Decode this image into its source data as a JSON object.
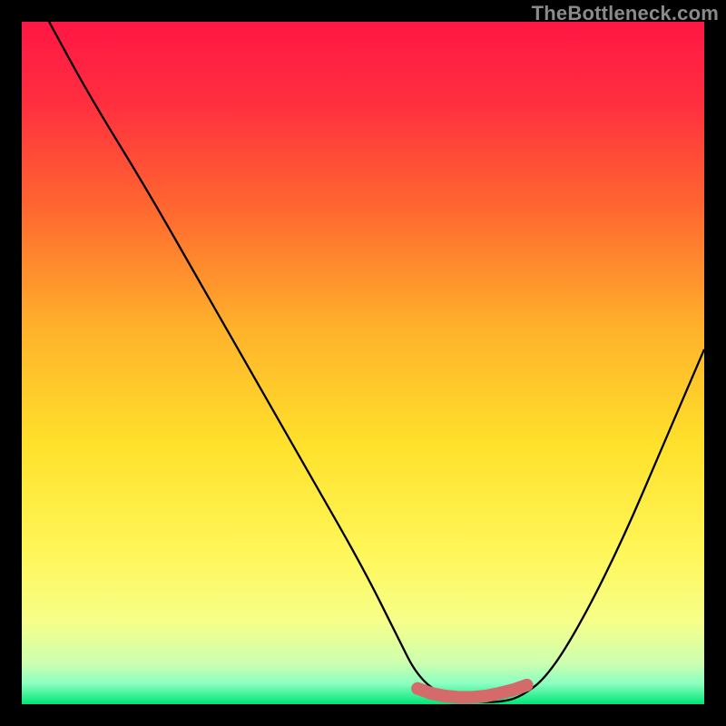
{
  "attribution": "TheBottleneck.com",
  "chart_data": {
    "type": "line",
    "title": "",
    "xlabel": "",
    "ylabel": "",
    "x_range": [
      0,
      100
    ],
    "y_range": [
      0,
      100
    ],
    "gradient_stops": [
      {
        "offset": 0.0,
        "color": "#ff1744"
      },
      {
        "offset": 0.12,
        "color": "#ff2f3f"
      },
      {
        "offset": 0.28,
        "color": "#ff6a2f"
      },
      {
        "offset": 0.45,
        "color": "#ffb22b"
      },
      {
        "offset": 0.62,
        "color": "#ffe12b"
      },
      {
        "offset": 0.78,
        "color": "#fff75a"
      },
      {
        "offset": 0.88,
        "color": "#f6ff8a"
      },
      {
        "offset": 0.94,
        "color": "#ccffb0"
      },
      {
        "offset": 0.97,
        "color": "#8affc0"
      },
      {
        "offset": 1.0,
        "color": "#00e676"
      }
    ],
    "series": [
      {
        "name": "bottleneck-curve",
        "color": "#000000",
        "x": [
          4,
          10,
          18,
          26,
          34,
          42,
          50,
          55,
          58,
          62,
          66,
          70,
          73,
          77,
          82,
          88,
          94,
          100
        ],
        "y": [
          100,
          89,
          76,
          62,
          48,
          34,
          20,
          10,
          4,
          1,
          0.3,
          0.3,
          1,
          4,
          12,
          24,
          38,
          52
        ]
      }
    ],
    "markers": {
      "name": "optimal-zone",
      "color": "#d46a6a",
      "x": [
        58,
        60,
        62,
        64,
        66,
        68,
        70,
        72,
        74
      ],
      "y": [
        2.3,
        1.6,
        1.2,
        1.0,
        1.0,
        1.2,
        1.6,
        2.1,
        2.8
      ]
    },
    "marker_dot": {
      "x": 74,
      "y": 2.8
    }
  }
}
